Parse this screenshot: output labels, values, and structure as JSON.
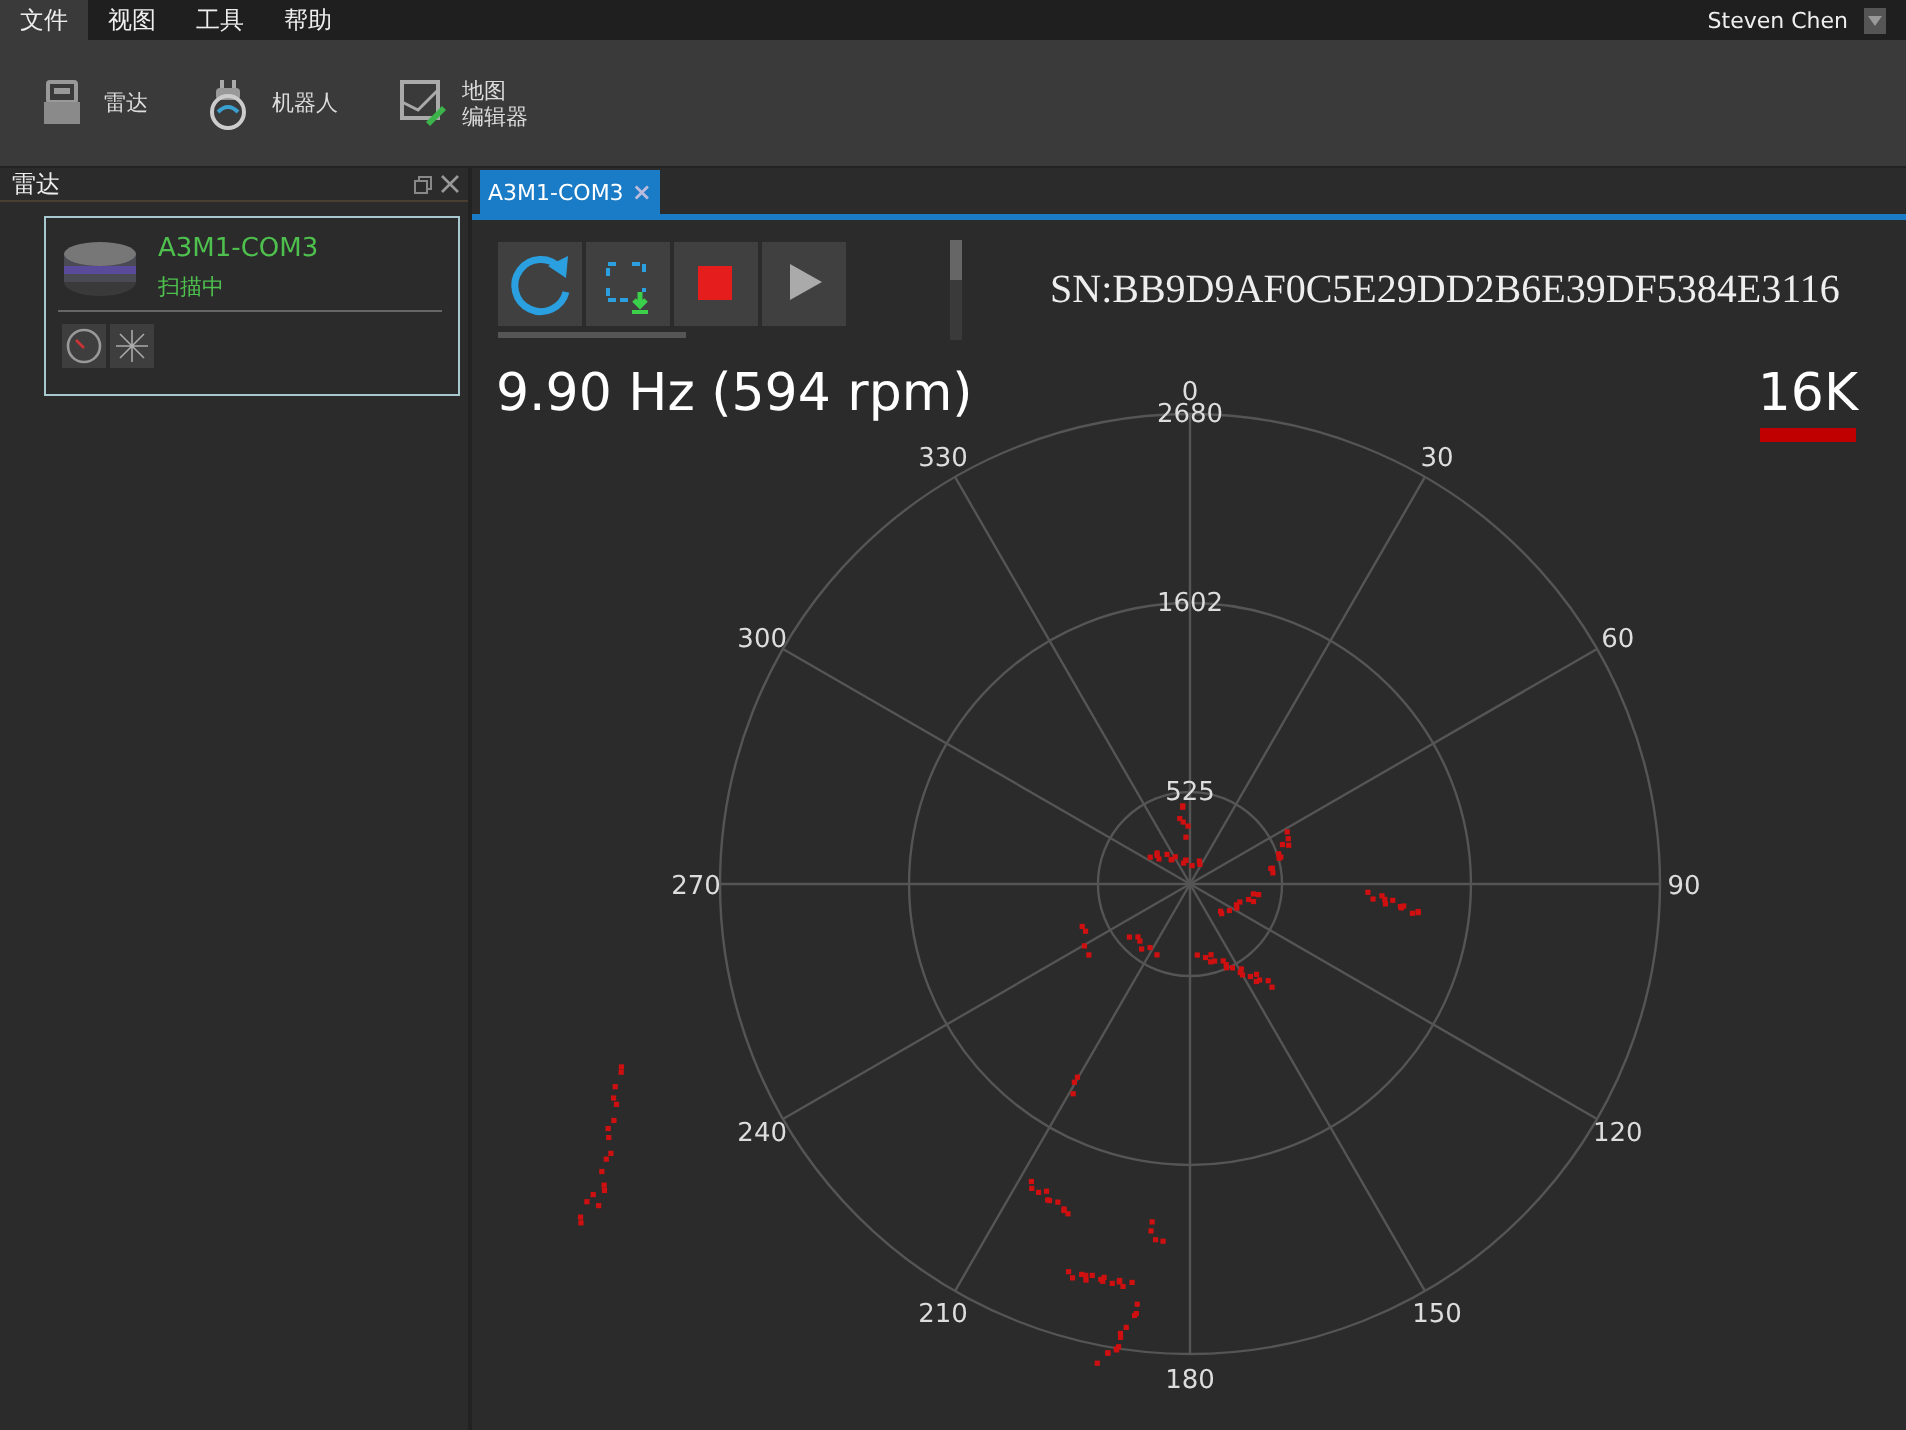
{
  "menu": [
    {
      "label": "文件",
      "selected": true
    },
    {
      "label": "视图",
      "selected": false
    },
    {
      "label": "工具",
      "selected": false
    },
    {
      "label": "帮助",
      "selected": false
    }
  ],
  "user": {
    "name": "Steven Chen"
  },
  "toolbar": [
    {
      "kind": "lidar",
      "lines": [
        "雷达"
      ]
    },
    {
      "kind": "robot",
      "lines": [
        "机器人"
      ]
    },
    {
      "kind": "map",
      "lines": [
        "地图",
        "编辑器"
      ]
    }
  ],
  "panel": {
    "title": "雷达",
    "device": {
      "name": "A3M1-COM3",
      "status": "扫描中"
    }
  },
  "tabs": [
    {
      "label": "A3M1-COM3",
      "close": "×",
      "selected": true
    }
  ],
  "controls": [
    {
      "kind": "refresh"
    },
    {
      "kind": "capture"
    },
    {
      "kind": "stop"
    },
    {
      "kind": "play"
    }
  ],
  "serial": "SN:BB9D9AF0C5E29DD2B6E39DF5384E3116",
  "frequency": "9.90 Hz (594 rpm)",
  "sample_rate": "16K",
  "polar": {
    "angle_labels": [
      "0",
      "30",
      "60",
      "90",
      "120",
      "150",
      "180",
      "210",
      "240",
      "270",
      "300",
      "330"
    ],
    "ring_labels": [
      "2680",
      "1602",
      "525"
    ]
  }
}
